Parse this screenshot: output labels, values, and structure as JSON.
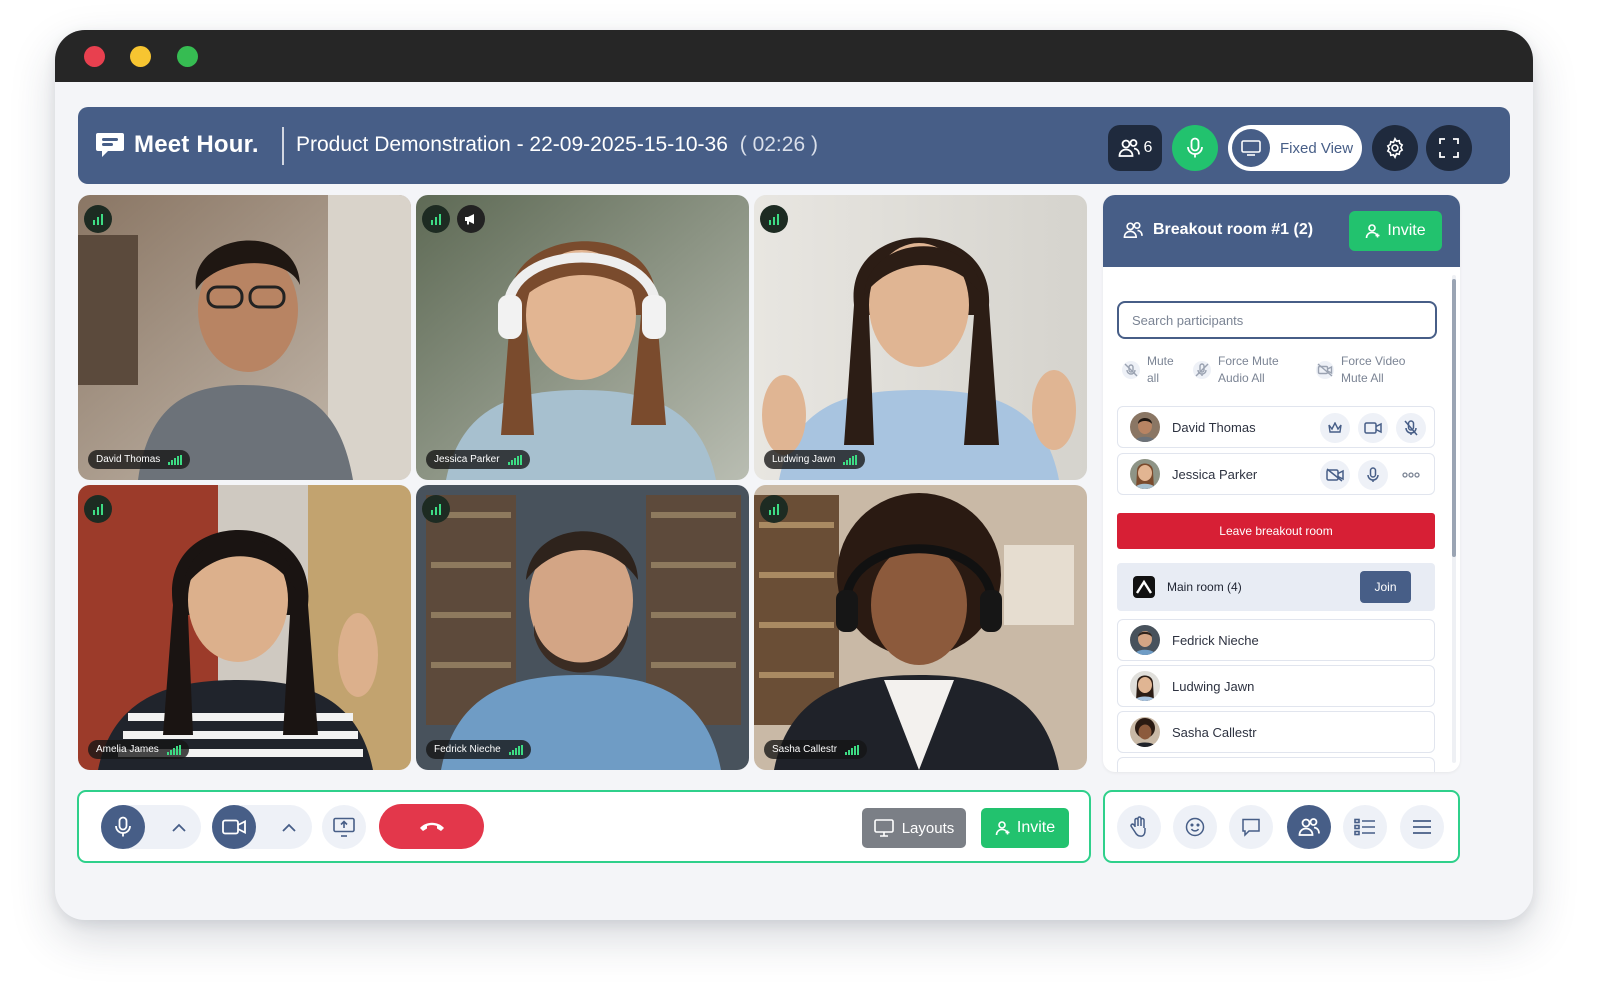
{
  "header": {
    "brand": "Meet Hour.",
    "meeting_title": "Product Demonstration - 22-09-2025-15-10-36",
    "timer": "( 02:26 )",
    "participant_count": "6",
    "view_mode": "Fixed View"
  },
  "tiles": [
    {
      "name": "David Thomas"
    },
    {
      "name": "Jessica Parker"
    },
    {
      "name": "Ludwing Jawn"
    },
    {
      "name": "Amelia James"
    },
    {
      "name": "Fedrick Nieche"
    },
    {
      "name": "Sasha Callestr"
    }
  ],
  "sidebar": {
    "title": "Breakout room #1 (2)",
    "invite_label": "Invite",
    "search_placeholder": "Search participants",
    "actions": [
      {
        "line1": "Mute",
        "line2": "all"
      },
      {
        "line1": "Force Mute",
        "line2": "Audio All"
      },
      {
        "line1": "Force Video",
        "line2": "Mute All"
      }
    ],
    "room_participants": [
      "David Thomas",
      "Jessica Parker"
    ],
    "leave_label": "Leave breakout room",
    "main_room_label": "Main room (4)",
    "join_label": "Join",
    "main_room_participants": [
      "Fedrick Nieche",
      "Ludwing Jawn",
      "Sasha Callestr"
    ]
  },
  "toolbar": {
    "layouts_label": "Layouts",
    "invite_label": "Invite"
  },
  "colors": {
    "brand_blue": "#475e87",
    "accent_green": "#22c26e",
    "hangup_red": "#e3374b",
    "leave_red": "#d71f35"
  }
}
